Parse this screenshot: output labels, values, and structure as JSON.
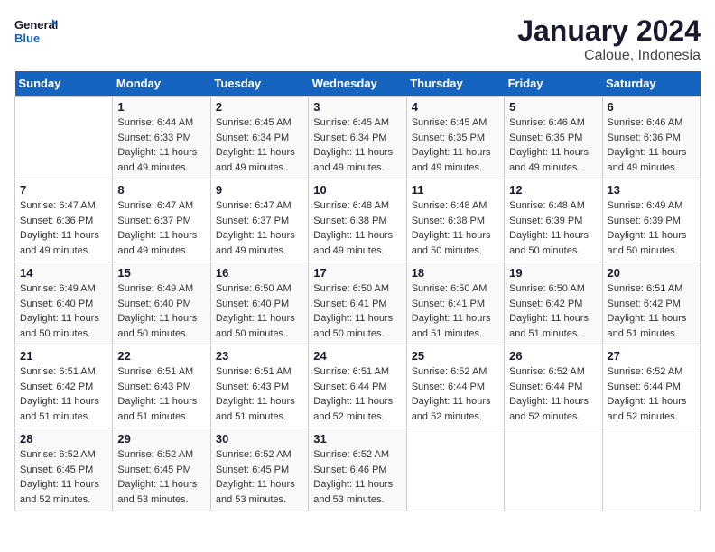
{
  "header": {
    "logo_line1": "General",
    "logo_line2": "Blue",
    "title": "January 2024",
    "subtitle": "Caloue, Indonesia"
  },
  "weekdays": [
    "Sunday",
    "Monday",
    "Tuesday",
    "Wednesday",
    "Thursday",
    "Friday",
    "Saturday"
  ],
  "weeks": [
    [
      {
        "day": "",
        "info": ""
      },
      {
        "day": "1",
        "info": "Sunrise: 6:44 AM\nSunset: 6:33 PM\nDaylight: 11 hours\nand 49 minutes."
      },
      {
        "day": "2",
        "info": "Sunrise: 6:45 AM\nSunset: 6:34 PM\nDaylight: 11 hours\nand 49 minutes."
      },
      {
        "day": "3",
        "info": "Sunrise: 6:45 AM\nSunset: 6:34 PM\nDaylight: 11 hours\nand 49 minutes."
      },
      {
        "day": "4",
        "info": "Sunrise: 6:45 AM\nSunset: 6:35 PM\nDaylight: 11 hours\nand 49 minutes."
      },
      {
        "day": "5",
        "info": "Sunrise: 6:46 AM\nSunset: 6:35 PM\nDaylight: 11 hours\nand 49 minutes."
      },
      {
        "day": "6",
        "info": "Sunrise: 6:46 AM\nSunset: 6:36 PM\nDaylight: 11 hours\nand 49 minutes."
      }
    ],
    [
      {
        "day": "7",
        "info": "Sunrise: 6:47 AM\nSunset: 6:36 PM\nDaylight: 11 hours\nand 49 minutes."
      },
      {
        "day": "8",
        "info": "Sunrise: 6:47 AM\nSunset: 6:37 PM\nDaylight: 11 hours\nand 49 minutes."
      },
      {
        "day": "9",
        "info": "Sunrise: 6:47 AM\nSunset: 6:37 PM\nDaylight: 11 hours\nand 49 minutes."
      },
      {
        "day": "10",
        "info": "Sunrise: 6:48 AM\nSunset: 6:38 PM\nDaylight: 11 hours\nand 49 minutes."
      },
      {
        "day": "11",
        "info": "Sunrise: 6:48 AM\nSunset: 6:38 PM\nDaylight: 11 hours\nand 50 minutes."
      },
      {
        "day": "12",
        "info": "Sunrise: 6:48 AM\nSunset: 6:39 PM\nDaylight: 11 hours\nand 50 minutes."
      },
      {
        "day": "13",
        "info": "Sunrise: 6:49 AM\nSunset: 6:39 PM\nDaylight: 11 hours\nand 50 minutes."
      }
    ],
    [
      {
        "day": "14",
        "info": "Sunrise: 6:49 AM\nSunset: 6:40 PM\nDaylight: 11 hours\nand 50 minutes."
      },
      {
        "day": "15",
        "info": "Sunrise: 6:49 AM\nSunset: 6:40 PM\nDaylight: 11 hours\nand 50 minutes."
      },
      {
        "day": "16",
        "info": "Sunrise: 6:50 AM\nSunset: 6:40 PM\nDaylight: 11 hours\nand 50 minutes."
      },
      {
        "day": "17",
        "info": "Sunrise: 6:50 AM\nSunset: 6:41 PM\nDaylight: 11 hours\nand 50 minutes."
      },
      {
        "day": "18",
        "info": "Sunrise: 6:50 AM\nSunset: 6:41 PM\nDaylight: 11 hours\nand 51 minutes."
      },
      {
        "day": "19",
        "info": "Sunrise: 6:50 AM\nSunset: 6:42 PM\nDaylight: 11 hours\nand 51 minutes."
      },
      {
        "day": "20",
        "info": "Sunrise: 6:51 AM\nSunset: 6:42 PM\nDaylight: 11 hours\nand 51 minutes."
      }
    ],
    [
      {
        "day": "21",
        "info": "Sunrise: 6:51 AM\nSunset: 6:42 PM\nDaylight: 11 hours\nand 51 minutes."
      },
      {
        "day": "22",
        "info": "Sunrise: 6:51 AM\nSunset: 6:43 PM\nDaylight: 11 hours\nand 51 minutes."
      },
      {
        "day": "23",
        "info": "Sunrise: 6:51 AM\nSunset: 6:43 PM\nDaylight: 11 hours\nand 51 minutes."
      },
      {
        "day": "24",
        "info": "Sunrise: 6:51 AM\nSunset: 6:44 PM\nDaylight: 11 hours\nand 52 minutes."
      },
      {
        "day": "25",
        "info": "Sunrise: 6:52 AM\nSunset: 6:44 PM\nDaylight: 11 hours\nand 52 minutes."
      },
      {
        "day": "26",
        "info": "Sunrise: 6:52 AM\nSunset: 6:44 PM\nDaylight: 11 hours\nand 52 minutes."
      },
      {
        "day": "27",
        "info": "Sunrise: 6:52 AM\nSunset: 6:44 PM\nDaylight: 11 hours\nand 52 minutes."
      }
    ],
    [
      {
        "day": "28",
        "info": "Sunrise: 6:52 AM\nSunset: 6:45 PM\nDaylight: 11 hours\nand 52 minutes."
      },
      {
        "day": "29",
        "info": "Sunrise: 6:52 AM\nSunset: 6:45 PM\nDaylight: 11 hours\nand 53 minutes."
      },
      {
        "day": "30",
        "info": "Sunrise: 6:52 AM\nSunset: 6:45 PM\nDaylight: 11 hours\nand 53 minutes."
      },
      {
        "day": "31",
        "info": "Sunrise: 6:52 AM\nSunset: 6:46 PM\nDaylight: 11 hours\nand 53 minutes."
      },
      {
        "day": "",
        "info": ""
      },
      {
        "day": "",
        "info": ""
      },
      {
        "day": "",
        "info": ""
      }
    ]
  ]
}
